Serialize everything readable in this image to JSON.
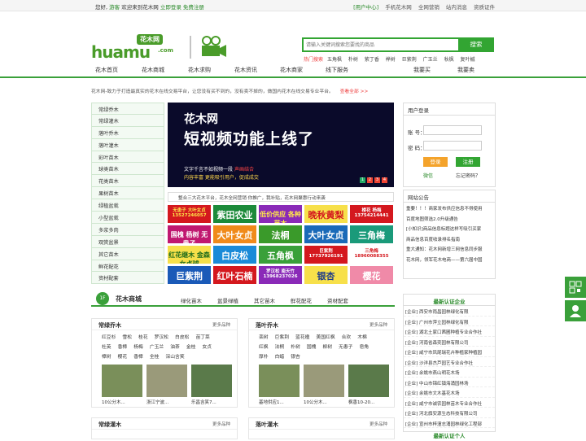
{
  "topbar": {
    "greeting": "您好,",
    "guest": "游客",
    "welcome": "欢迎来到花木网",
    "login": "立即登录",
    "register": "免费注册",
    "user_center": "[用户中心]",
    "mobile": "手机花木网",
    "marketing": "全网营销",
    "messages": "站内消息",
    "cert": "资质证件"
  },
  "logo": {
    "brand": "huamu",
    "cn": "花木网",
    "com": ".com"
  },
  "search": {
    "placeholder": "请输入关键词搜索您要找的商品",
    "button": "搜索",
    "hot_label": "热门搜索",
    "hot": [
      "五角枫",
      "朴树",
      "紫丁香",
      "榉树",
      "巨紫荆",
      "广玉兰",
      "秋枫",
      "复叶槭"
    ]
  },
  "nav": [
    "花木首页",
    "花木商城",
    "花木求购",
    "花木资讯",
    "花木商家",
    "线下服务",
    "我要买",
    "我要卖"
  ],
  "intro": {
    "text": "花木网-致力于打造最真实的花木在线交易平台，让您没有买不到的，没有卖不掉的，做国内花木在线交易专业平台。",
    "more": "查看全部 >>"
  },
  "categories": [
    "常绿乔木",
    "常绿灌木",
    "落叶乔木",
    "落叶灌木",
    "彩叶苗木",
    "球类苗木",
    "花类苗木",
    "果树苗木",
    "绿植盆栽",
    "小型盆栽",
    "多浆多肉",
    "观赏盆景",
    "其它苗木",
    "鲜花配花",
    "资材配套"
  ],
  "banner": {
    "l1": "花木网",
    "l2": "短视频功能上线了",
    "l3": "文字千言不如视频一段",
    "l3b": "声画结合",
    "l4": "内容丰富 更能吸引用户，促成成交",
    "dots": [
      "1",
      "2",
      "3",
      "4"
    ],
    "marquee": "整合三大花木平台，花木全网营销      你推广，我补贴，花木网聚惠行动来袭"
  },
  "ads": [
    {
      "t": "无患子 大叶女贞 13527246057",
      "bg": "#d4181e",
      "fg": "#ffe94a"
    },
    {
      "t": "紫田农业",
      "bg": "#1c8a3a",
      "fg": "#fff"
    },
    {
      "t": "低价供应 各种苗木",
      "bg": "#8a2ab8",
      "fg": "#ffe94a"
    },
    {
      "t": "晚秋黄梨",
      "bg": "#f7e04a",
      "fg": "#d4181e"
    },
    {
      "t": "楼花 杨梅 13754214441",
      "bg": "#d4181e",
      "fg": "#fff"
    },
    {
      "t": "国槐 杨树 无患子",
      "bg": "#c01870",
      "fg": "#fff"
    },
    {
      "t": "大叶女贞",
      "bg": "#f08a1a",
      "fg": "#fff"
    },
    {
      "t": "法桐",
      "bg": "#3a9a2a",
      "fg": "#fff"
    },
    {
      "t": "大叶女贞",
      "bg": "#1a6ab8",
      "fg": "#fff"
    },
    {
      "t": "三角梅",
      "bg": "#1a9a7a",
      "fg": "#fff"
    },
    {
      "t": "红花继木 金森女贞球",
      "bg": "#f7e04a",
      "fg": "#1c6a1a"
    },
    {
      "t": "白皮松",
      "bg": "#1a8ad8",
      "fg": "#fff"
    },
    {
      "t": "五角枫",
      "bg": "#3aa03a",
      "fg": "#fff"
    },
    {
      "t": "巨紫荆 17737926191",
      "bg": "#d4181e",
      "fg": "#fff"
    },
    {
      "t": "三角梅 18960088355",
      "bg": "#fff",
      "fg": "#d4181e"
    },
    {
      "t": "巨紫荆",
      "bg": "#1a5ab8",
      "fg": "#fff"
    },
    {
      "t": "红叶石楠",
      "bg": "#d4181e",
      "fg": "#fff"
    },
    {
      "t": "罗汉松 南天竹 13968237026",
      "bg": "#8a2ab8",
      "fg": "#fff"
    },
    {
      "t": "银杏",
      "bg": "#f7e04a",
      "fg": "#1c3a8a"
    },
    {
      "t": "樱花",
      "bg": "#f08aa8",
      "fg": "#fff"
    }
  ],
  "login": {
    "title": "用户登录",
    "account": "账 号：",
    "password": "密 码：",
    "login": "登录",
    "register": "注册",
    "wechat": "微信",
    "forgot": "忘记密码？"
  },
  "notice": {
    "title": "网站公告",
    "items": [
      "重要！！！商家发布供应信息不得使用",
      "百度地图筛选2.0升级通告",
      "[小知识]商品信息标题这样写吸引买家",
      "商品信息百度收录排名指南",
      "重大通知：花木网新增三网信息同步服",
      "花木网，领军花木电商——第六届中国"
    ]
  },
  "floor": {
    "num": "1F",
    "title": "花木商城",
    "tabs": [
      "绿化苗木",
      "盆景绿植",
      "其它苗木",
      "鲜花配花",
      "资材配套"
    ]
  },
  "panels": [
    {
      "title": "常绿乔木",
      "more": "更多品种",
      "kw": [
        "红豆杉",
        "雪松",
        "桂花",
        "罗汉松",
        "白皮松",
        "苗丁菜",
        "杜英",
        "香樟",
        "杨梅",
        "广玉兰",
        "油茶",
        "金桂",
        "女贞",
        "樟树",
        "樱花",
        "香樟",
        "全桂",
        "深山含笑"
      ],
      "thumbs": [
        "10公分木...",
        "浙江宁波...",
        "乐昌含笑7..."
      ]
    },
    {
      "title": "落叶乔木",
      "more": "更多品种",
      "kw": [
        "栾树",
        "巨紫荆",
        "蓝花楹",
        "美国红枫",
        "合欢",
        "木棉",
        "红枫",
        "法桐",
        "朴树",
        "国槐",
        "柳树",
        "无患子",
        "皂角",
        "厚朴",
        "白蜡",
        "银杏"
      ],
      "thumbs": [
        "基地供应1...",
        "10公分木...",
        "枫香10-20..."
      ]
    },
    {
      "title": "常绿灌木",
      "more": "更多品种"
    },
    {
      "title": "落叶灌木",
      "more": "更多品种"
    }
  ],
  "cert": {
    "title": "最新认证企业",
    "items": [
      "[企业] 西安市雨昌园林绿化有限",
      "[企业] 广州市萍立园林绿化有限",
      "[企业] 湖北土家口茜圃种植专业合作社",
      "[企业] 河南省森奕园林有限公司",
      "[企业] 咸宁市凤尾瑞花卉种植家种植园",
      "[企业] 沙洋县杰芦园艺专业合作社",
      "[企业] 余姚市燕山明花木场",
      "[企业] 中山市锦红镇海涌园林场",
      "[企业] 余姚市文木基花木场",
      "[企业] 咸宁市诚农园林苗木专业合作社",
      "[企业] 河北旗安源生态科技有限公司",
      "[企业] 宣州市梓潼志涌园林绿化工程部"
    ],
    "title2": "最新认证个人"
  }
}
